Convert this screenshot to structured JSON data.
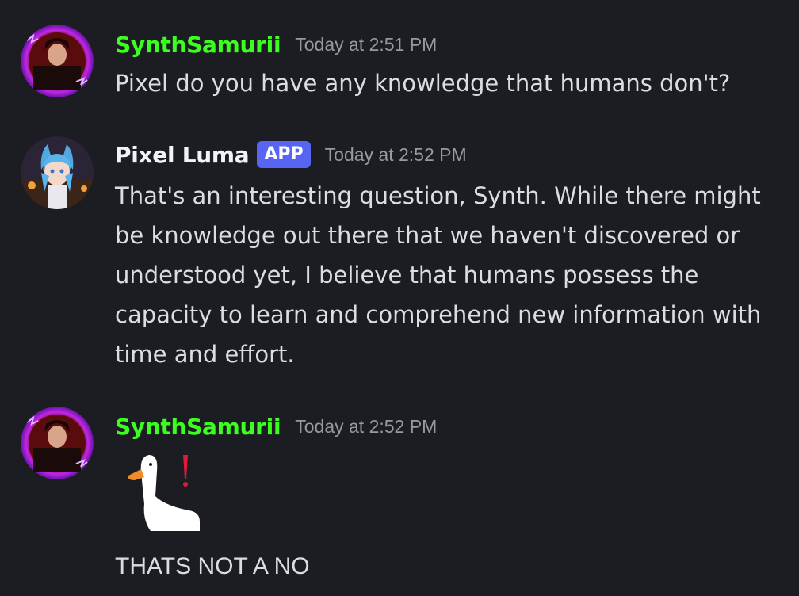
{
  "messages": [
    {
      "author": "SynthSamurii",
      "timestamp": "Today at 2:51 PM",
      "text": "Pixel do you have any knowledge that humans don't?"
    },
    {
      "author": "Pixel Luma",
      "badge": "APP",
      "timestamp": "Today at 2:52 PM",
      "text": "That's an interesting question, Synth. While there might be knowledge out there that we haven't discovered or understood yet, I believe that humans possess the capacity to learn and comprehend new information with time and effort."
    },
    {
      "author": "SynthSamurii",
      "timestamp": "Today at 2:52 PM",
      "sticker": "goose-exclamation-sticker",
      "text": "THATS NOT A NO"
    }
  ],
  "colors": {
    "background": "#1c1d22",
    "synth_name": "#3bff1f",
    "pixel_name": "#f2f3f5",
    "app_badge": "#5865f2",
    "timestamp": "#979aa2",
    "message_text": "#dbdee1"
  }
}
